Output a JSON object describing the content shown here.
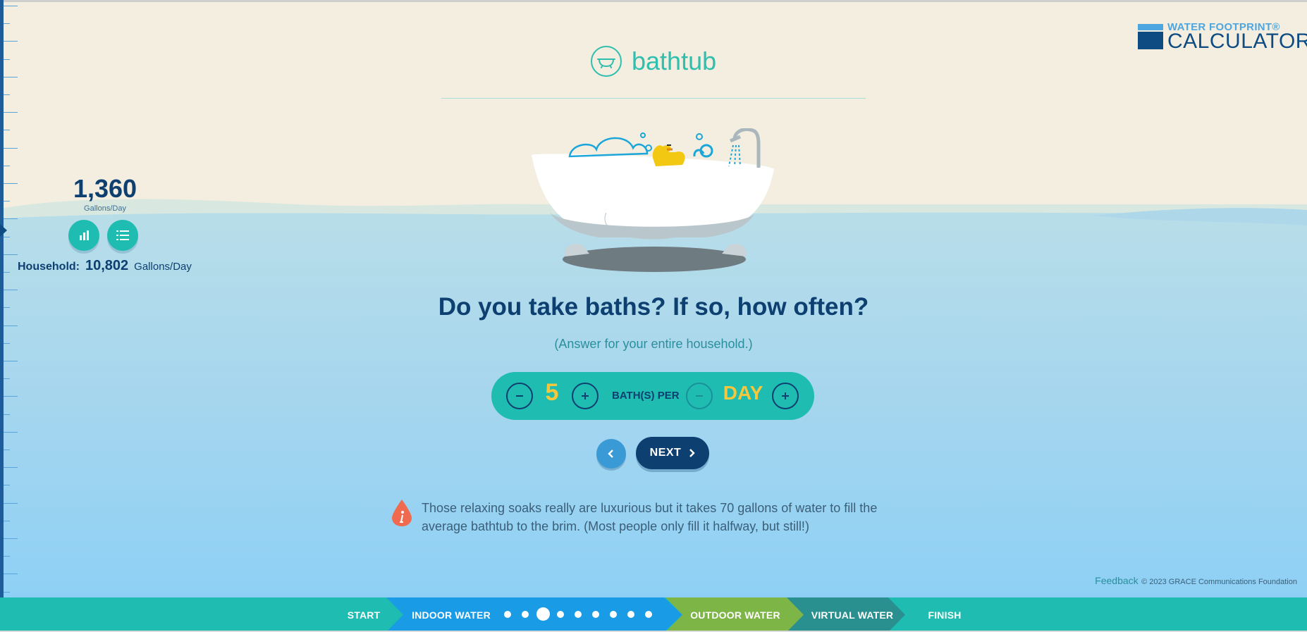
{
  "page": {
    "title": "bathtub"
  },
  "brand": {
    "line1": "WATER FOOTPRINT®",
    "line2": "CALCULATOR"
  },
  "stats": {
    "personal_value": "1,360",
    "personal_unit": "Gallons/Day",
    "household_label": "Household:",
    "household_value": "10,802",
    "household_unit": "Gallons/Day"
  },
  "question": {
    "text": "Do you take baths? If so, how often?",
    "subtext": "(Answer for your entire household.)"
  },
  "control": {
    "count": "5",
    "label": "BATH(S) PER",
    "period": "DAY"
  },
  "nav": {
    "next_label": "NEXT"
  },
  "info": {
    "text": "Those relaxing soaks really are luxurious but it takes 70 gallons of water to fill the average bathtub to the brim. (Most people only fill it halfway, but still!)"
  },
  "footer": {
    "feedback": "Feedback",
    "copyright": "© 2023 GRACE Communications Foundation"
  },
  "progress": {
    "steps": [
      {
        "label": "START"
      },
      {
        "label": "INDOOR WATER"
      },
      {
        "label": "OUTDOOR WATER"
      },
      {
        "label": "VIRTUAL WATER"
      },
      {
        "label": "FINISH"
      }
    ],
    "indoor_dot_count": 9,
    "indoor_current_dot": 3
  },
  "colors": {
    "teal": "#1fbcb1",
    "navy": "#0d3f70",
    "blue_step": "#1a9be6",
    "green_step": "#7db546",
    "dark_teal_step": "#2a8f8f",
    "yellow_value": "#f6c63c",
    "beige_bg": "#f4eee0"
  }
}
